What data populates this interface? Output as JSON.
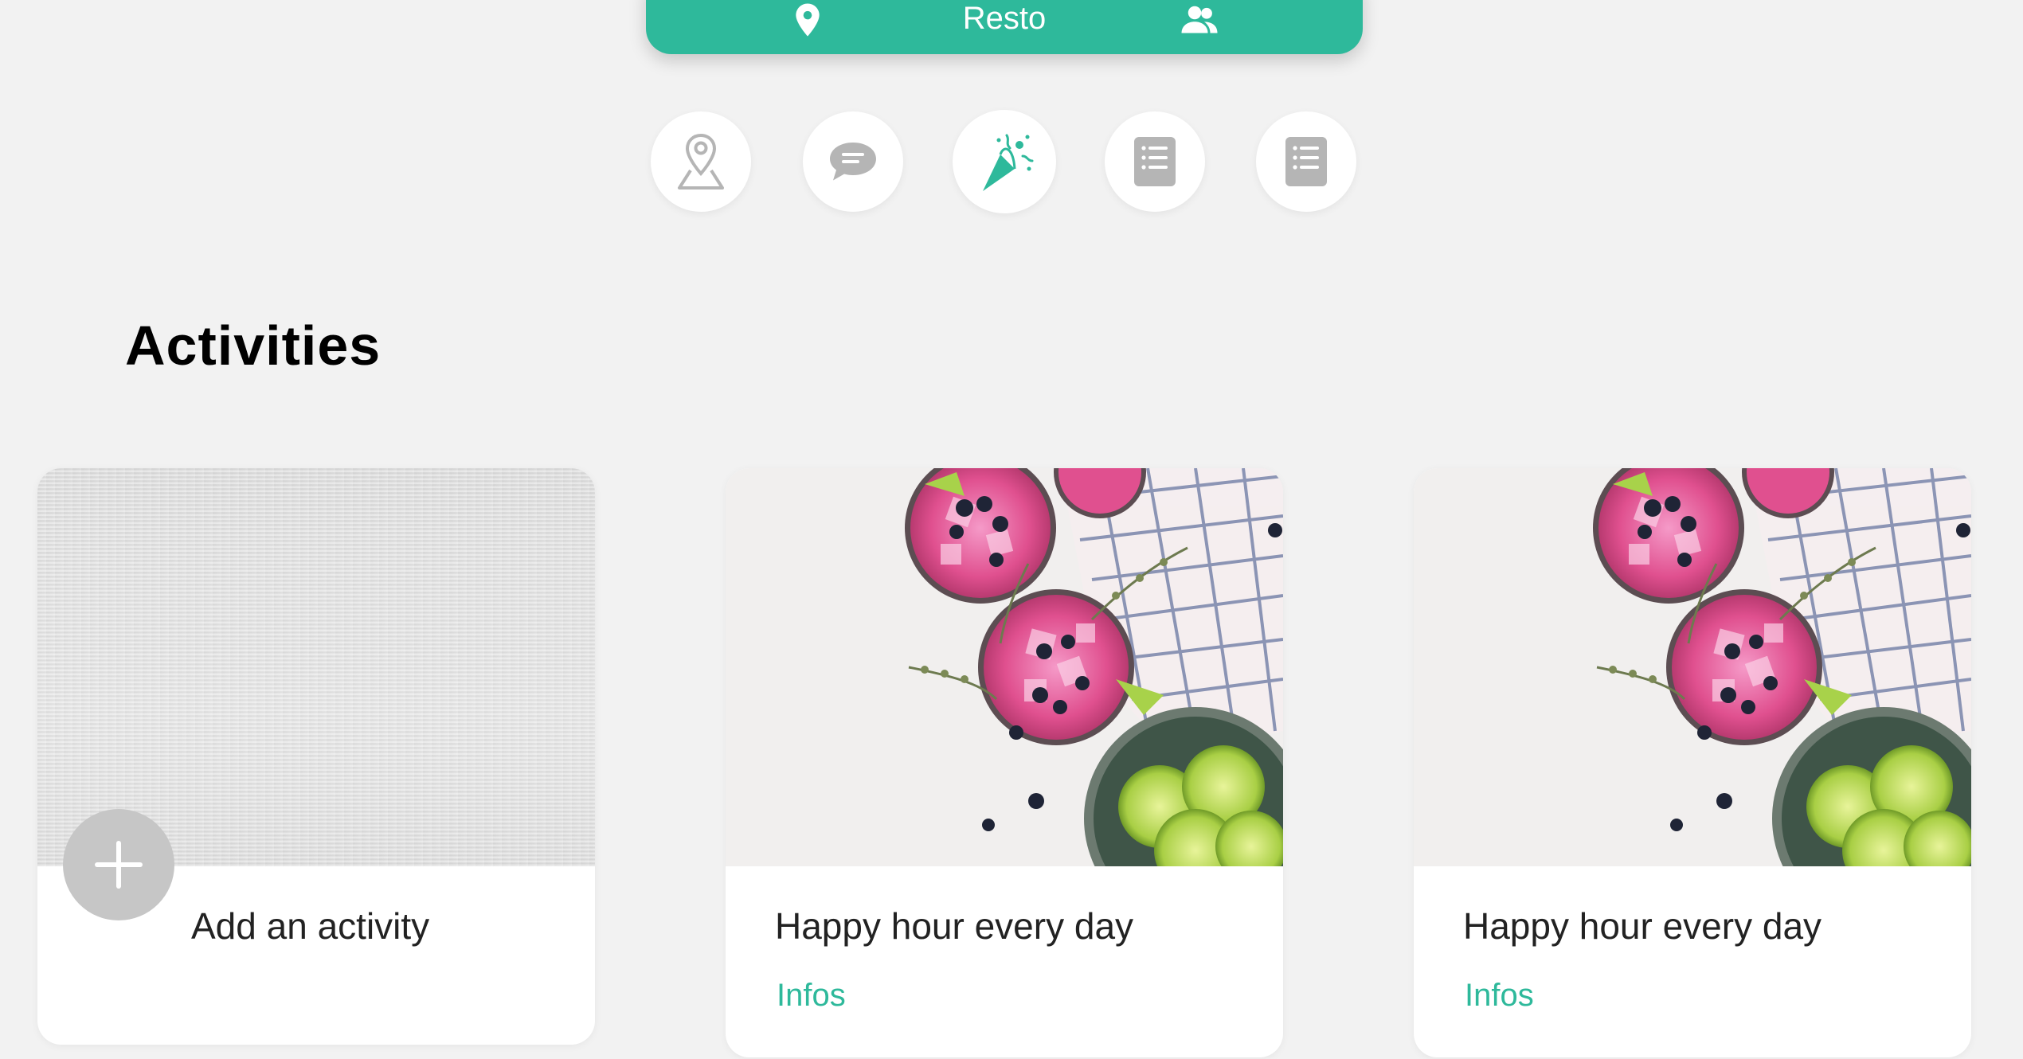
{
  "topbar": {
    "title": "Resto",
    "icons": [
      "location-pin-icon",
      "users-icon"
    ]
  },
  "nav_circles": [
    {
      "name": "map-pin-icon",
      "active": false
    },
    {
      "name": "chat-icon",
      "active": false
    },
    {
      "name": "party-popper-icon",
      "active": true
    },
    {
      "name": "list-document-icon",
      "active": false
    },
    {
      "name": "list-document-icon",
      "active": false
    }
  ],
  "section": {
    "title": "Activities"
  },
  "cards": [
    {
      "title": "Add an activity",
      "image": "gray-texture",
      "action_icon": "plus-icon"
    },
    {
      "title": "Happy hour every day",
      "link": "Infos",
      "image": "pink-drinks-limes"
    },
    {
      "title": "Happy hour every day",
      "link": "Infos",
      "image": "pink-drinks-limes"
    }
  ],
  "colors": {
    "accent": "#2eb99b",
    "background": "#f2f2f2",
    "icon_gray": "#b5b5b5"
  }
}
